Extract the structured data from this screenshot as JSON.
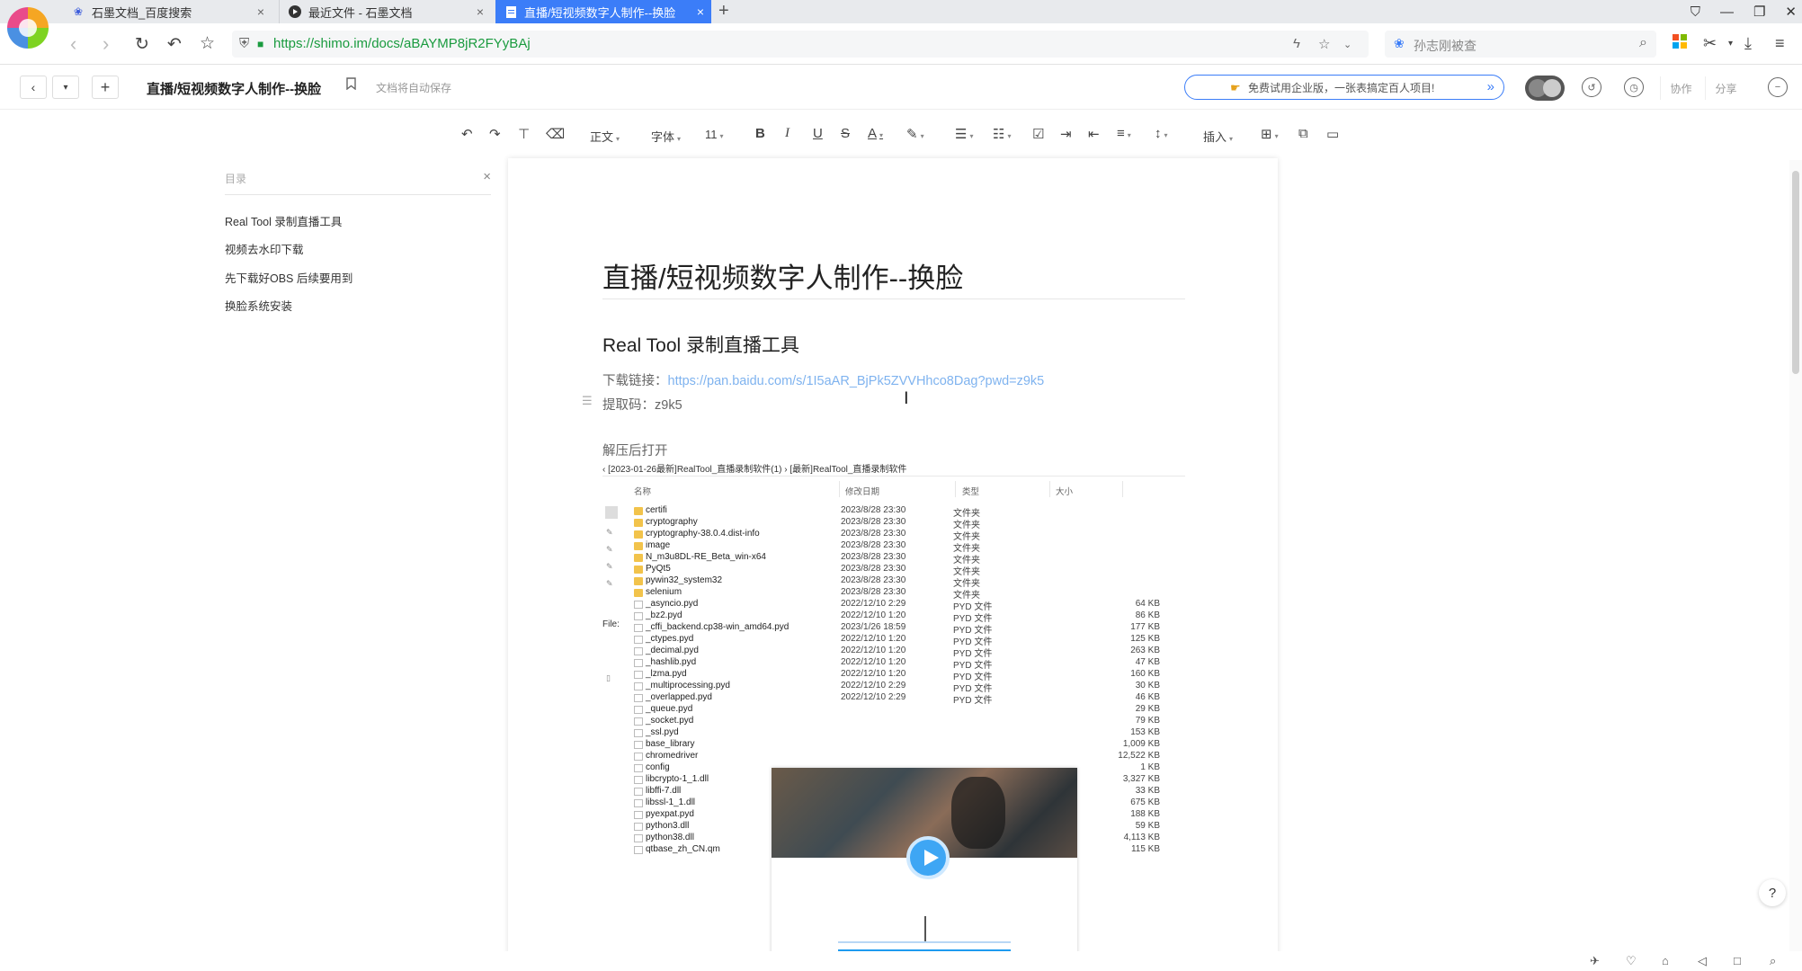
{
  "browser": {
    "tabs": [
      {
        "title": "石墨文档_百度搜索"
      },
      {
        "title": "最近文件 - 石墨文档"
      },
      {
        "title": "直播/短视频数字人制作--换脸"
      }
    ],
    "url": "https://shimo.im/docs/aBAYMP8jR2FYyBAj",
    "search_text": "孙志刚被查"
  },
  "header": {
    "title": "直播/短视频数字人制作--换脸",
    "autosave": "文档将自动保存",
    "promo": "免费试用企业版，一张表搞定百人项目!",
    "collab_label": "协作",
    "share_label": "分享"
  },
  "toolbar": {
    "style_label": "正文",
    "font_label": "字体",
    "size_label": "11",
    "insert_label": "插入"
  },
  "outline": {
    "title": "目录",
    "items": [
      {
        "label": "Real Tool 录制直播工具"
      },
      {
        "label": "视频去水印下载"
      },
      {
        "label": "先下载好OBS 后续要用到"
      },
      {
        "label": "换脸系统安装"
      }
    ]
  },
  "doc": {
    "h1": "直播/短视频数字人制作--换脸",
    "h2": "Real Tool 录制直播工具",
    "download_label": "下载链接：",
    "download_link": "https://pan.baidu.com/s/1I5aAR_BjPk5ZVVHhco8Dag?pwd=z9k5",
    "code_line": "提取码：z9k5",
    "after_unzip": "解压后打开"
  },
  "explorer": {
    "crumb": "‹  [2023-01-26最新]RealTool_直播录制软件(1)  ›  [最新]RealTool_直播录制软件",
    "columns": {
      "name": "名称",
      "date": "修改日期",
      "type": "类型",
      "size": "大小"
    },
    "side_label": "File:",
    "files": [
      {
        "name": "certifi",
        "date": "2023/8/28 23:30",
        "type": "文件夹",
        "size": "",
        "kind": "folder"
      },
      {
        "name": "cryptography",
        "date": "2023/8/28 23:30",
        "type": "文件夹",
        "size": "",
        "kind": "folder"
      },
      {
        "name": "cryptography-38.0.4.dist-info",
        "date": "2023/8/28 23:30",
        "type": "文件夹",
        "size": "",
        "kind": "folder"
      },
      {
        "name": "image",
        "date": "2023/8/28 23:30",
        "type": "文件夹",
        "size": "",
        "kind": "folder"
      },
      {
        "name": "N_m3u8DL-RE_Beta_win-x64",
        "date": "2023/8/28 23:30",
        "type": "文件夹",
        "size": "",
        "kind": "folder"
      },
      {
        "name": "PyQt5",
        "date": "2023/8/28 23:30",
        "type": "文件夹",
        "size": "",
        "kind": "folder"
      },
      {
        "name": "pywin32_system32",
        "date": "2023/8/28 23:30",
        "type": "文件夹",
        "size": "",
        "kind": "folder"
      },
      {
        "name": "selenium",
        "date": "2023/8/28 23:30",
        "type": "文件夹",
        "size": "",
        "kind": "folder"
      },
      {
        "name": "_asyncio.pyd",
        "date": "2022/12/10 2:29",
        "type": "PYD 文件",
        "size": "64 KB",
        "kind": "file"
      },
      {
        "name": "_bz2.pyd",
        "date": "2022/12/10 1:20",
        "type": "PYD 文件",
        "size": "86 KB",
        "kind": "file"
      },
      {
        "name": "_cffi_backend.cp38-win_amd64.pyd",
        "date": "2023/1/26 18:59",
        "type": "PYD 文件",
        "size": "177 KB",
        "kind": "file"
      },
      {
        "name": "_ctypes.pyd",
        "date": "2022/12/10 1:20",
        "type": "PYD 文件",
        "size": "125 KB",
        "kind": "file"
      },
      {
        "name": "_decimal.pyd",
        "date": "2022/12/10 1:20",
        "type": "PYD 文件",
        "size": "263 KB",
        "kind": "file"
      },
      {
        "name": "_hashlib.pyd",
        "date": "2022/12/10 1:20",
        "type": "PYD 文件",
        "size": "47 KB",
        "kind": "file"
      },
      {
        "name": "_lzma.pyd",
        "date": "2022/12/10 1:20",
        "type": "PYD 文件",
        "size": "160 KB",
        "kind": "file"
      },
      {
        "name": "_multiprocessing.pyd",
        "date": "2022/12/10 2:29",
        "type": "PYD 文件",
        "size": "30 KB",
        "kind": "file"
      },
      {
        "name": "_overlapped.pyd",
        "date": "2022/12/10 2:29",
        "type": "PYD 文件",
        "size": "46 KB",
        "kind": "file"
      },
      {
        "name": "_queue.pyd",
        "date": "",
        "type": "",
        "size": "29 KB",
        "kind": "file"
      },
      {
        "name": "_socket.pyd",
        "date": "",
        "type": "",
        "size": "79 KB",
        "kind": "file"
      },
      {
        "name": "_ssl.pyd",
        "date": "",
        "type": "",
        "size": "153 KB",
        "kind": "file"
      },
      {
        "name": "base_library",
        "date": "",
        "type": "",
        "size": "1,009 KB",
        "kind": "file"
      },
      {
        "name": "chromedriver",
        "date": "",
        "type": "",
        "size": "12,522 KB",
        "kind": "file"
      },
      {
        "name": "config",
        "date": "",
        "type": "",
        "size": "1 KB",
        "kind": "file"
      },
      {
        "name": "libcrypto-1_1.dll",
        "date": "",
        "type": "",
        "size": "3,327 KB",
        "kind": "file"
      },
      {
        "name": "libffi-7.dll",
        "date": "",
        "type": "",
        "size": "33 KB",
        "kind": "file"
      },
      {
        "name": "libssl-1_1.dll",
        "date": "",
        "type": "",
        "size": "675 KB",
        "kind": "file"
      },
      {
        "name": "pyexpat.pyd",
        "date": "",
        "type": "",
        "size": "188 KB",
        "kind": "file"
      },
      {
        "name": "python3.dll",
        "date": "",
        "type": "",
        "size": "59 KB",
        "kind": "file"
      },
      {
        "name": "python38.dll",
        "date": "",
        "type": "",
        "size": "4,113 KB",
        "kind": "file"
      },
      {
        "name": "qtbase_zh_CN.qm",
        "date": "",
        "type": "",
        "size": "115 KB",
        "kind": "file"
      }
    ]
  },
  "colors": {
    "accent": "#3b7df8",
    "link": "#7fb3ef",
    "url_green": "#1a9b3f",
    "folder": "#f2c34b",
    "play": "#3ea6f4"
  },
  "icons": [
    "paw-icon",
    "play-circle-icon",
    "doc-icon",
    "close-icon",
    "plus-icon",
    "back-icon",
    "forward-icon",
    "refresh-icon",
    "undo-icon",
    "star-icon",
    "shield-icon",
    "lightning-icon",
    "search-icon",
    "download-icon",
    "menu-icon",
    "bookmark-icon",
    "history-icon",
    "clock-icon",
    "minus-circle-icon",
    "help-icon"
  ]
}
